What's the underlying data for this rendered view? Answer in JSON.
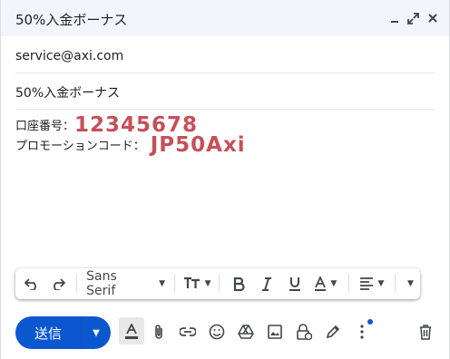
{
  "window": {
    "title": "50%入金ボーナス"
  },
  "to": {
    "value": "service@axi.com"
  },
  "subject": {
    "value": "50%入金ボーナス"
  },
  "body": {
    "line1_label": "口座番号：",
    "line1_value": "12345678",
    "line2_label": "プロモーションコード：",
    "line2_value": "JP50Axi"
  },
  "toolbar": {
    "font": "Sans Serif"
  },
  "send": {
    "label": "送信"
  },
  "colors": {
    "accent": "#0b57d0",
    "highlight_text": "#c5505a"
  }
}
